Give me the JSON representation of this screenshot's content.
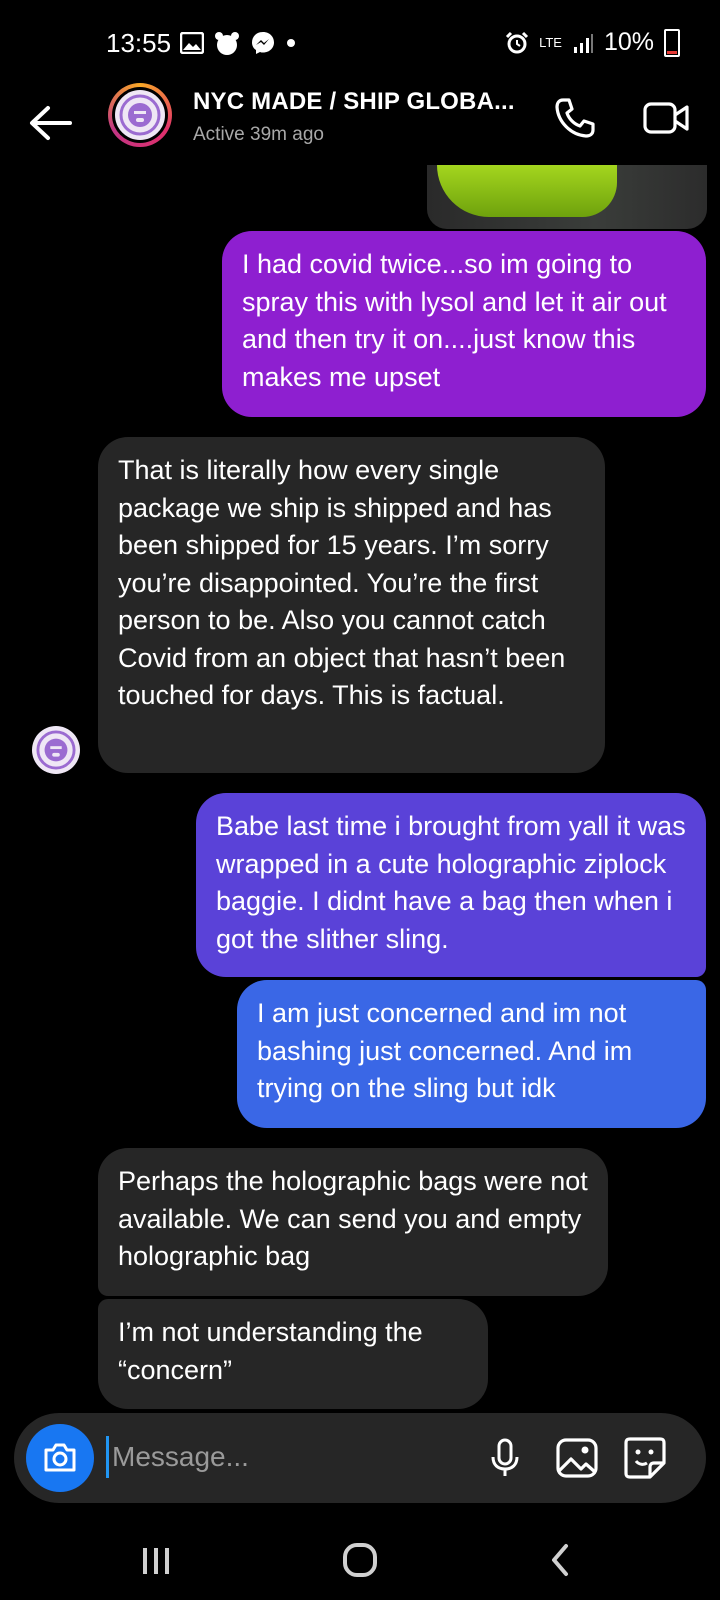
{
  "status_bar": {
    "time": "13:55",
    "battery": "10%",
    "network": "LTE"
  },
  "header": {
    "title": "NYC MADE / SHIP GLOBA...",
    "subtitle": "Active 39m ago"
  },
  "messages": [
    {
      "from": "me",
      "text": "I had covid twice...so im going to spray this with lysol and let it air out and then try it on....just know this makes me upset"
    },
    {
      "from": "them",
      "text": "That is literally how every single package we ship is shipped and has been shipped for 15 years. I’m sorry you’re disappointed. You’re the first person to be. Also you cannot catch Covid from an object that hasn’t been touched for days. This is factual."
    },
    {
      "from": "me",
      "text": "Babe last time i brought from yall it was wrapped in a cute holographic ziplock baggie. I didnt have a bag then when i got the slither sling."
    },
    {
      "from": "me",
      "text": "I am just concerned and im not bashing just concerned. And im trying on the sling but idk"
    },
    {
      "from": "them",
      "text": "Perhaps the holographic bags were not available. We can send you and empty holographic bag"
    },
    {
      "from": "them",
      "text": "I’m not understanding the “concern”"
    }
  ],
  "composer": {
    "placeholder": "Message..."
  },
  "colors": {
    "bubble_out_1": "#8e1fd0",
    "bubble_out_2": "#5a42d8",
    "bubble_out_3": "#3a67e6",
    "bubble_in": "#262626",
    "camera_button": "#1877f2"
  }
}
